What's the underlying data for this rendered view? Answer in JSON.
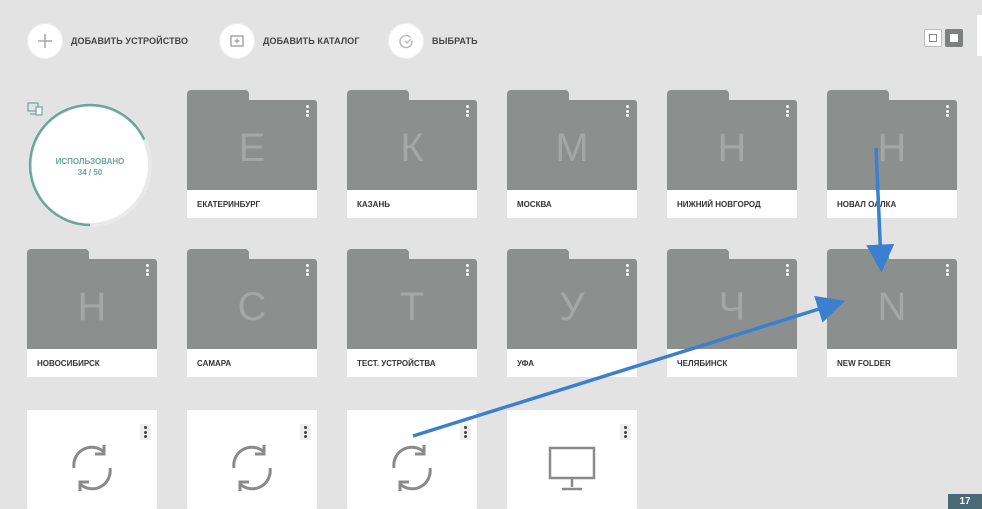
{
  "toolbar": {
    "add_device": "ДОБАВИТЬ УСТРОЙСТВО",
    "add_catalog": "ДОБАВИТЬ КАТАЛОГ",
    "select": "ВЫБРАТЬ"
  },
  "usage": {
    "label": "ИСПОЛЬЗОВАНО",
    "count": "34 / 50",
    "used": 34,
    "total": 50,
    "accent": "#6aa79b"
  },
  "folders": [
    {
      "letter": "Е",
      "name": "ЕКАТЕРИНБУРГ"
    },
    {
      "letter": "К",
      "name": "КАЗАНЬ"
    },
    {
      "letter": "М",
      "name": "МОСКВА"
    },
    {
      "letter": "Н",
      "name": "НИЖНИЙ НОВГОРОД"
    },
    {
      "letter": "Н",
      "name": "НОВАЛ ОАЛКА"
    },
    {
      "letter": "Н",
      "name": "НОВОСИБИРСК"
    },
    {
      "letter": "С",
      "name": "САМАРА"
    },
    {
      "letter": "Т",
      "name": "ТЕСТ. УСТРОЙСТВА"
    },
    {
      "letter": "У",
      "name": "УФА"
    },
    {
      "letter": "Ч",
      "name": "ЧЕЛЯБИНСК"
    },
    {
      "letter": "N",
      "name": "NEW FOLDER"
    }
  ],
  "devices": [
    {
      "icon": "sync-icon"
    },
    {
      "icon": "sync-icon"
    },
    {
      "icon": "sync-icon"
    },
    {
      "icon": "monitor-icon"
    }
  ],
  "corner_badge": "17",
  "colors": {
    "folder": "#8b8f8d",
    "arrow": "#3a7fd0",
    "background": "#e3e3e3"
  }
}
